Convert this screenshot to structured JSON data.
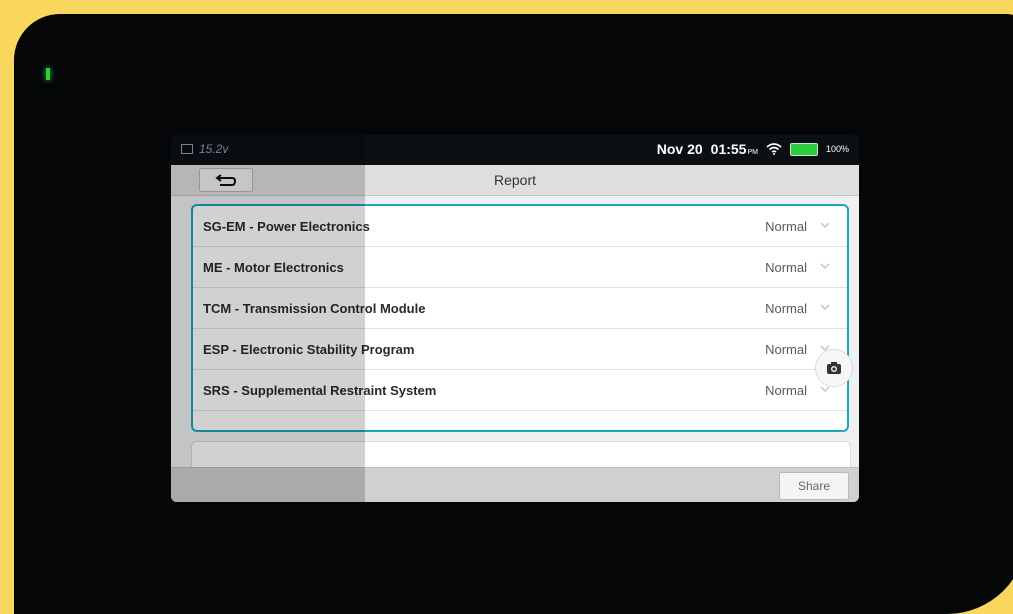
{
  "statusbar": {
    "voltage": "15.2v",
    "date": "Nov 20",
    "time": "01:55",
    "ampm": "PM",
    "battery": "100%"
  },
  "header": {
    "title": "Report"
  },
  "modules": [
    {
      "name": "SG-EM - Power Electronics",
      "status": "Normal"
    },
    {
      "name": "ME - Motor Electronics",
      "status": "Normal"
    },
    {
      "name": "TCM - Transmission Control Module",
      "status": "Normal"
    },
    {
      "name": "ESP - Electronic Stability Program",
      "status": "Normal"
    },
    {
      "name": "SRS - Supplemental Restraint System",
      "status": "Normal"
    }
  ],
  "footer": {
    "share_label": "Share"
  },
  "colors": {
    "accent": "#1aa7b8",
    "battery": "#2ecc40",
    "frame": "#f8d75c"
  }
}
